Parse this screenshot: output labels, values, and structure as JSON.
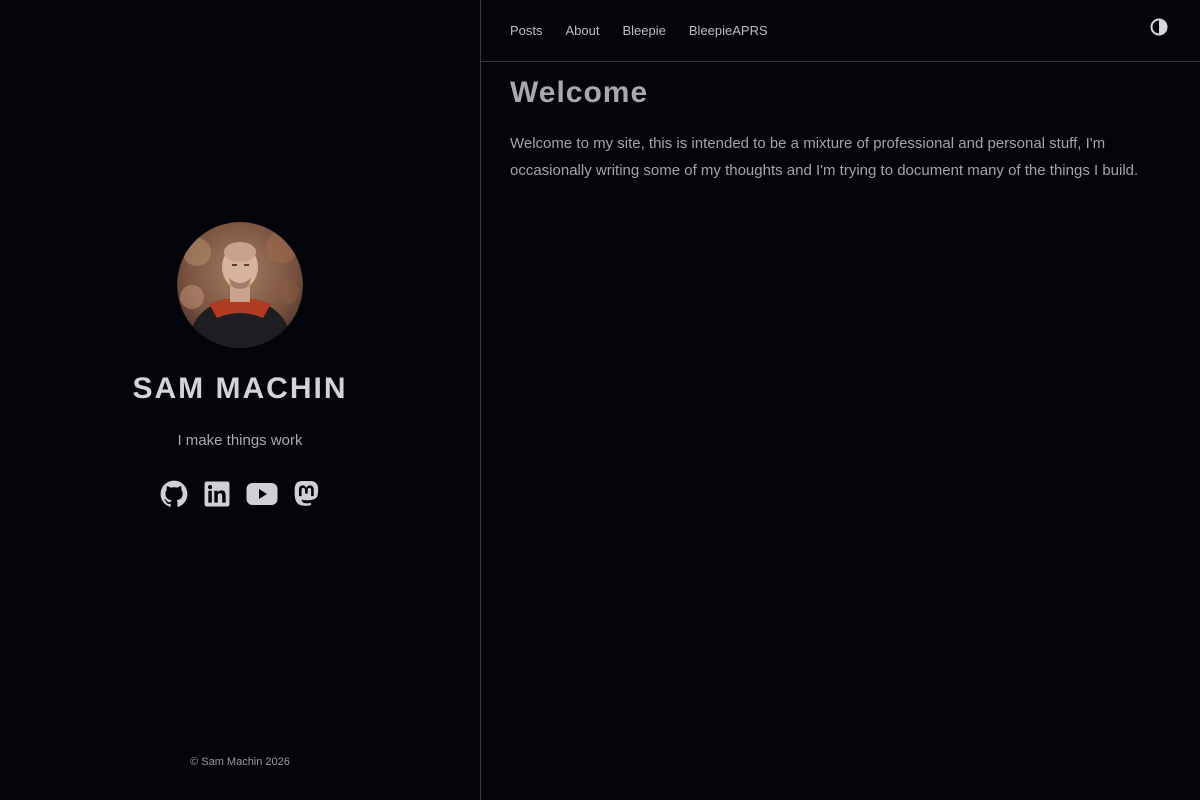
{
  "sidebar": {
    "name": "SAM MACHIN",
    "tagline": "I make things work",
    "copyright": "© Sam Machin 2026",
    "socials": [
      {
        "icon": "github-icon"
      },
      {
        "icon": "linkedin-icon"
      },
      {
        "icon": "youtube-icon"
      },
      {
        "icon": "mastodon-icon"
      }
    ]
  },
  "nav": {
    "items": [
      "Posts",
      "About",
      "Bleepie",
      "BleepieAPRS"
    ],
    "theme_toggle_icon": "contrast-icon"
  },
  "main": {
    "title": "Welcome",
    "intro": "Welcome to my site, this is intended to be a mixture of professional and personal stuff, I'm occasionally writing some of my thoughts and I'm trying to document many of the things I build."
  },
  "colors": {
    "background": "#03040a",
    "border": "#3a3a3e",
    "text": "#c9c9cc"
  }
}
